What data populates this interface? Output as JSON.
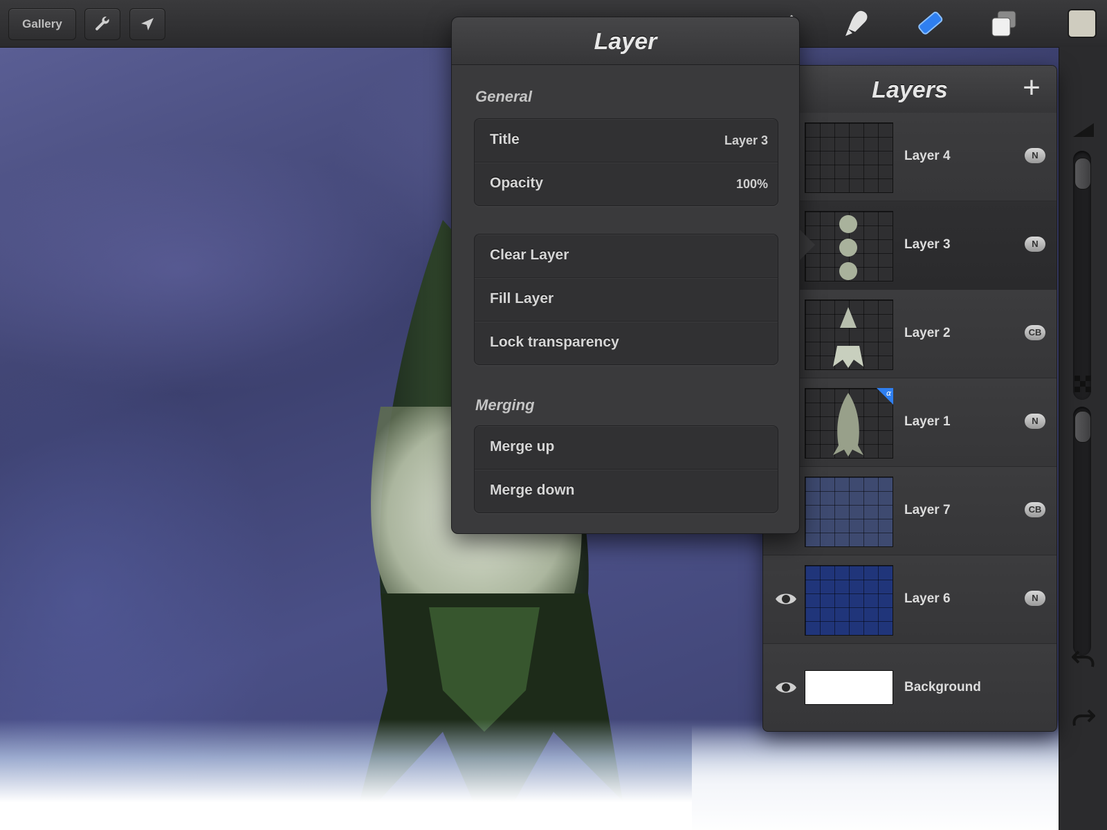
{
  "toolbar": {
    "gallery_label": "Gallery",
    "tools": [
      "wrench-icon",
      "cursor-icon",
      "brush-icon",
      "smudge-icon",
      "eraser-icon",
      "layers-icon",
      "color-swatch"
    ],
    "accent_color": "#3b8cff"
  },
  "popover": {
    "title": "Layer",
    "general_label": "General",
    "title_row": {
      "label": "Title",
      "value": "Layer 3"
    },
    "opacity_row": {
      "label": "Opacity",
      "value": "100%"
    },
    "actions": {
      "clear": "Clear Layer",
      "fill": "Fill Layer",
      "lock": "Lock transparency"
    },
    "merging_label": "Merging",
    "merge": {
      "up": "Merge up",
      "down": "Merge down"
    }
  },
  "layers": {
    "title": "Layers",
    "add_label": "+",
    "items": [
      {
        "name": "Layer 4",
        "blend": "N",
        "visible": false,
        "selected": false
      },
      {
        "name": "Layer 3",
        "blend": "N",
        "visible": false,
        "selected": true
      },
      {
        "name": "Layer 2",
        "blend": "CB",
        "visible": false,
        "selected": false
      },
      {
        "name": "Layer 1",
        "blend": "N",
        "visible": false,
        "selected": false,
        "alpha_lock": true
      },
      {
        "name": "Layer 7",
        "blend": "CB",
        "visible": false,
        "selected": false
      },
      {
        "name": "Layer 6",
        "blend": "N",
        "visible": true,
        "selected": false
      },
      {
        "name": "Background",
        "blend": "",
        "visible": true,
        "selected": false
      }
    ]
  }
}
